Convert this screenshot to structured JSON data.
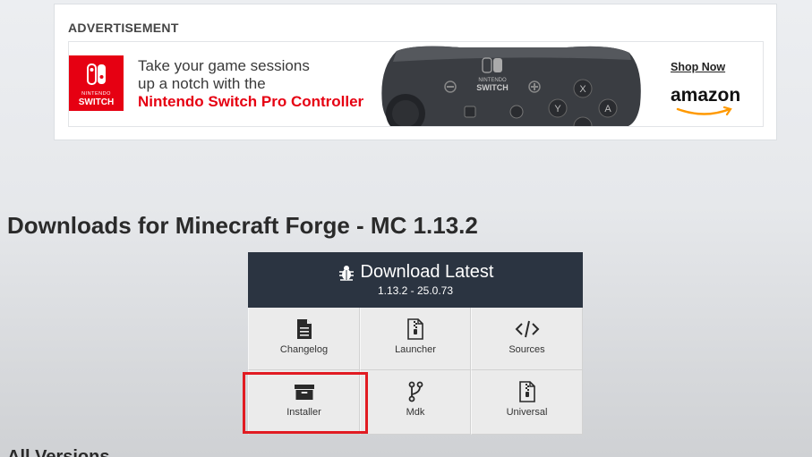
{
  "ad": {
    "label": "ADVERTISEMENT",
    "brand_small": "NINTENDO",
    "brand_big": "SWITCH",
    "line1": "Take your game sessions",
    "line2": "up a notch with the",
    "line3": "Nintendo Switch Pro Controller",
    "controller_brand_small": "NINTENDO",
    "controller_brand_big": "SWITCH",
    "shop_now": "Shop Now",
    "amazon": "amazon"
  },
  "page": {
    "title": "Downloads for Minecraft Forge - MC 1.13.2",
    "next_section": "All Versions"
  },
  "download": {
    "latest_label": "Download Latest",
    "latest_version": "1.13.2 - 25.0.73",
    "items": [
      {
        "label": "Changelog",
        "icon": "document-icon"
      },
      {
        "label": "Launcher",
        "icon": "zip-file-icon"
      },
      {
        "label": "Sources",
        "icon": "code-icon"
      },
      {
        "label": "Installer",
        "icon": "archive-box-icon"
      },
      {
        "label": "Mdk",
        "icon": "branch-icon"
      },
      {
        "label": "Universal",
        "icon": "zip-file-icon"
      }
    ]
  },
  "colors": {
    "header_bg": "#2b3441",
    "accent_red": "#e60012",
    "highlight": "#e11b22"
  }
}
